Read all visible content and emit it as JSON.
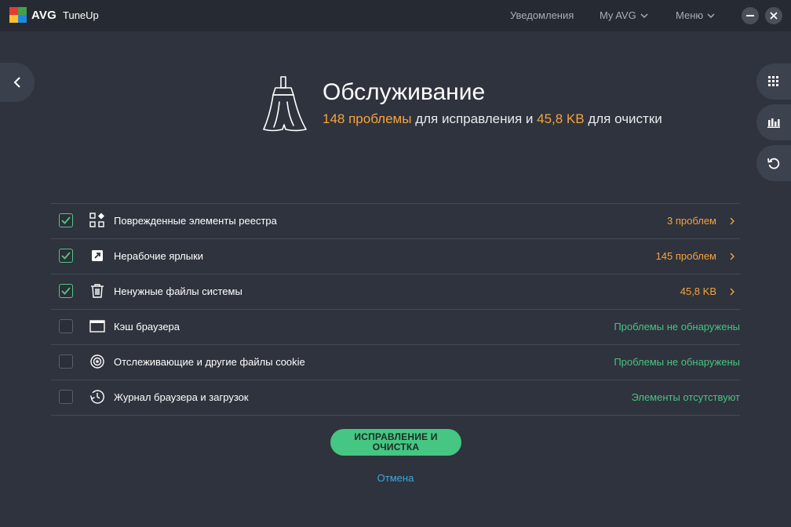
{
  "header": {
    "brand": "AVG",
    "product": "TuneUp",
    "menu_notifications": "Уведомления",
    "menu_myavg": "My AVG",
    "menu_main": "Меню"
  },
  "hero": {
    "title": "Обслуживание",
    "problems": "148 проблемы",
    "sub_mid": " для исправления и ",
    "size": "45,8 KB",
    "sub_end": " для очистки"
  },
  "items": [
    {
      "label": "Поврежденные элементы реестра",
      "status": "3 проблем",
      "checked": true,
      "icon": "registry-icon"
    },
    {
      "label": "Нерабочие ярлыки",
      "status": "145 проблем",
      "checked": true,
      "icon": "shortcut-icon"
    },
    {
      "label": "Ненужные файлы системы",
      "status": "45,8 KB",
      "checked": true,
      "icon": "trash-icon"
    },
    {
      "label": "Кэш браузера",
      "status": "Проблемы не обнаружены",
      "checked": false,
      "icon": "browser-window-icon"
    },
    {
      "label": "Отслеживающие и другие файлы cookie",
      "status": "Проблемы не обнаружены",
      "checked": false,
      "icon": "target-icon"
    },
    {
      "label": "Журнал браузера и загрузок",
      "status": "Элементы отсутствуют",
      "checked": false,
      "icon": "history-icon"
    }
  ],
  "actions": {
    "fix_line1": "ИСПРАВЛЕНИЕ И",
    "fix_line2": "ОЧИСТКА",
    "cancel": "Отмена"
  },
  "colors": {
    "background": "#2e333d",
    "titlebar": "#262a32",
    "accent_orange": "#f6a33d",
    "accent_green": "#45c682",
    "link_blue": "#3aa8e4"
  }
}
